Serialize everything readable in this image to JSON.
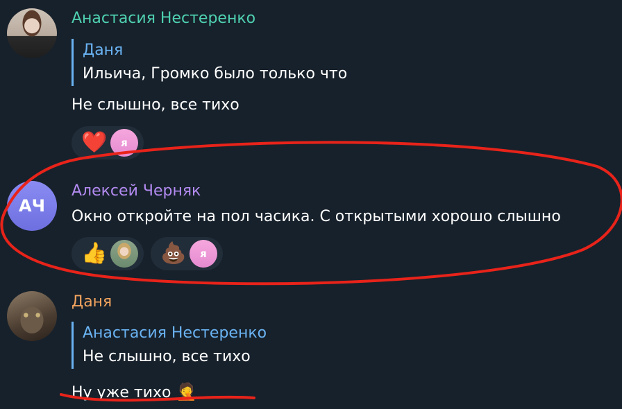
{
  "messages": [
    {
      "sender": "Анастасия Нестеренко",
      "sender_color": "#4fd1b0",
      "reply": {
        "name": "Даня",
        "text": "Ильича, Громко было только что"
      },
      "text": "Не слышно, все тихо",
      "reactions": [
        {
          "emoji": "❤️",
          "icon": "heart-icon"
        }
      ]
    },
    {
      "sender": "Алексей Черняк",
      "sender_color": "#b28af0",
      "avatar_initials": "АЧ",
      "text": "Окно откройте на пол часика. С открытыми хорошо слышно",
      "reactions": [
        {
          "emoji": "👍",
          "icon": "thumbs-up-icon"
        },
        {
          "emoji": "💩",
          "icon": "poop-icon"
        }
      ]
    },
    {
      "sender": "Даня",
      "sender_color": "#f2a35e",
      "reply": {
        "name": "Анастасия Нестеренко",
        "text": "Не слышно, все тихо"
      },
      "text": "Ну уже тихо",
      "emoji": "🤦",
      "emoji_icon": "facepalm-icon"
    }
  ],
  "mini_avatar_glyph": "ᴙ",
  "annotation_color": "#e8231a"
}
